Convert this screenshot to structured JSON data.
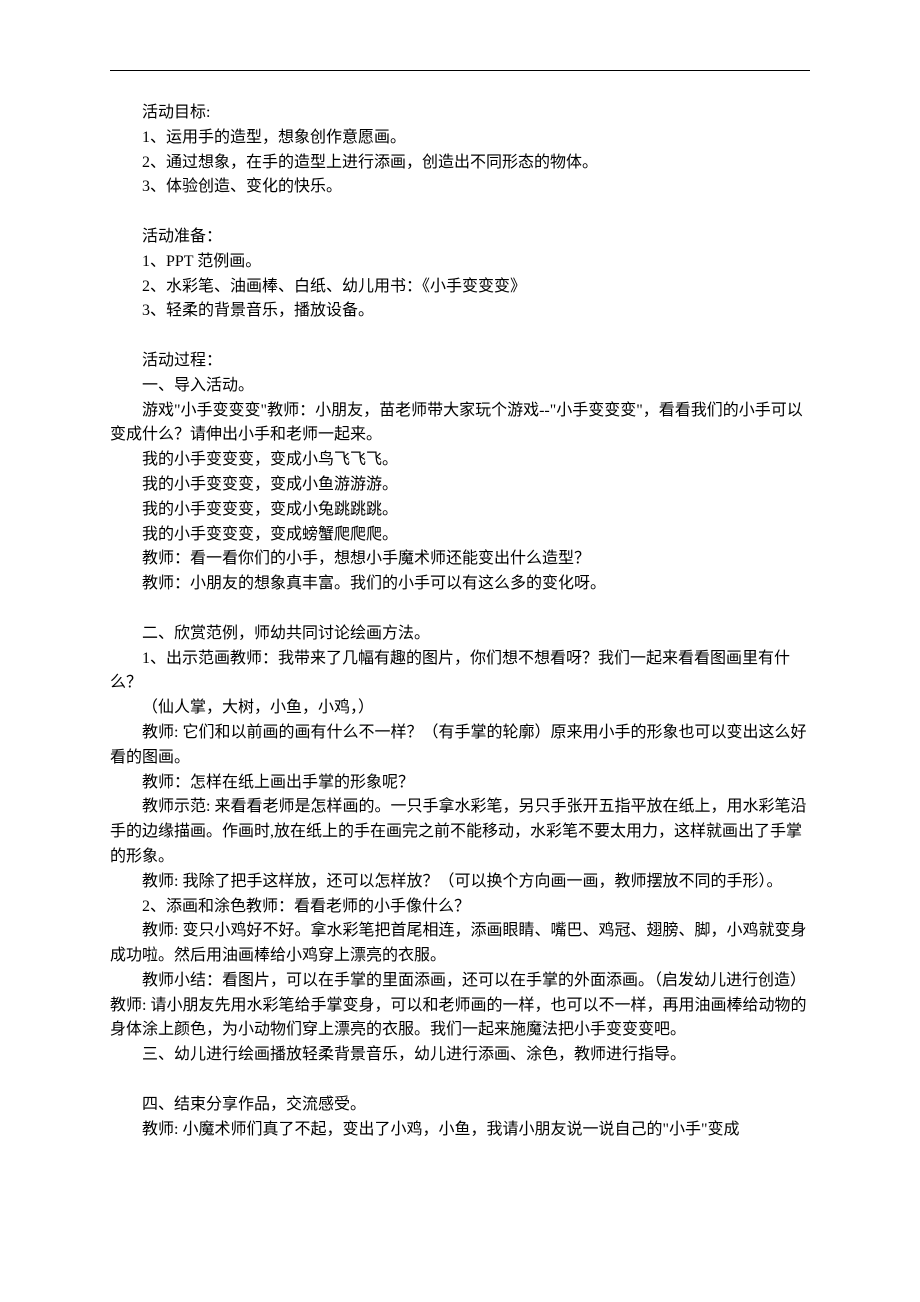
{
  "sections": {
    "goals_title": "活动目标:",
    "goals": [
      "1、运用手的造型，想象创作意愿画。",
      "2、通过想象，在手的造型上进行添画，创造出不同形态的物体。",
      "3、体验创造、变化的快乐。"
    ],
    "prep_title": "活动准备：",
    "prep": [
      "1、PPT 范例画。",
      "2、水彩笔、油画棒、白纸、幼儿用书：《小手变变变》",
      "3、轻柔的背景音乐，播放设备。"
    ],
    "proc_title": "活动过程：",
    "proc": {
      "intro_title": "一、导入活动。",
      "intro_p1": "游戏\"小手变变变\"教师：小朋友，苗老师带大家玩个游戏--\"小手变变变\"，看看我们的小手可以变成什么？请伸出小手和老师一起来。",
      "chant": [
        "我的小手变变变，变成小鸟飞飞飞。",
        "我的小手变变变，变成小鱼游游游。",
        "我的小手变变变，变成小兔跳跳跳。",
        "我的小手变变变，变成螃蟹爬爬爬。"
      ],
      "intro_p2": "教师：看一看你们的小手，想想小手魔术师还能变出什么造型？",
      "intro_p3": "教师：小朋友的想象真丰富。我们的小手可以有这么多的变化呀。",
      "s2_title": "二、欣赏范例，师幼共同讨论绘画方法。",
      "s2_p1": "1、出示范画教师：我带来了几幅有趣的图片，你们想不想看呀？我们一起来看看图画里有什么？",
      "s2_p2": "（仙人掌，大树，小鱼，小鸡，）",
      "s2_p3": "教师: 它们和以前画的画有什么不一样？（有手掌的轮廓）原来用小手的形象也可以变出这么好看的图画。",
      "s2_p4": "教师：怎样在纸上画出手掌的形象呢？",
      "s2_p5": "教师示范: 来看看老师是怎样画的。一只手拿水彩笔，另只手张开五指平放在纸上，用水彩笔沿手的边缘描画。作画时,放在纸上的手在画完之前不能移动，水彩笔不要太用力，这样就画出了手掌的形象。",
      "s2_p6": "教师: 我除了把手这样放，还可以怎样放？（可以换个方向画一画，教师摆放不同的手形）。",
      "s2_p7": "2、添画和涂色教师：看看老师的小手像什么？",
      "s2_p8": "教师: 变只小鸡好不好。拿水彩笔把首尾相连，添画眼睛、嘴巴、鸡冠、翅膀、脚，小鸡就变身成功啦。然后用油画棒给小鸡穿上漂亮的衣服。",
      "s2_p9": "教师小结：看图片，可以在手掌的里面添画，还可以在手掌的外面添画。（启发幼儿进行创造）教师: 请小朋友先用水彩笔给手掌变身，可以和老师画的一样，也可以不一样，再用油画棒给动物的身体涂上颜色，为小动物们穿上漂亮的衣服。我们一起来施魔法把小手变变变吧。",
      "s3": "三、幼儿进行绘画播放轻柔背景音乐，幼儿进行添画、涂色，教师进行指导。",
      "s4_title": "四、结束分享作品，交流感受。",
      "s4_p1": "教师: 小魔术师们真了不起，变出了小鸡，小鱼，我请小朋友说一说自己的\"小手\"变成"
    }
  }
}
